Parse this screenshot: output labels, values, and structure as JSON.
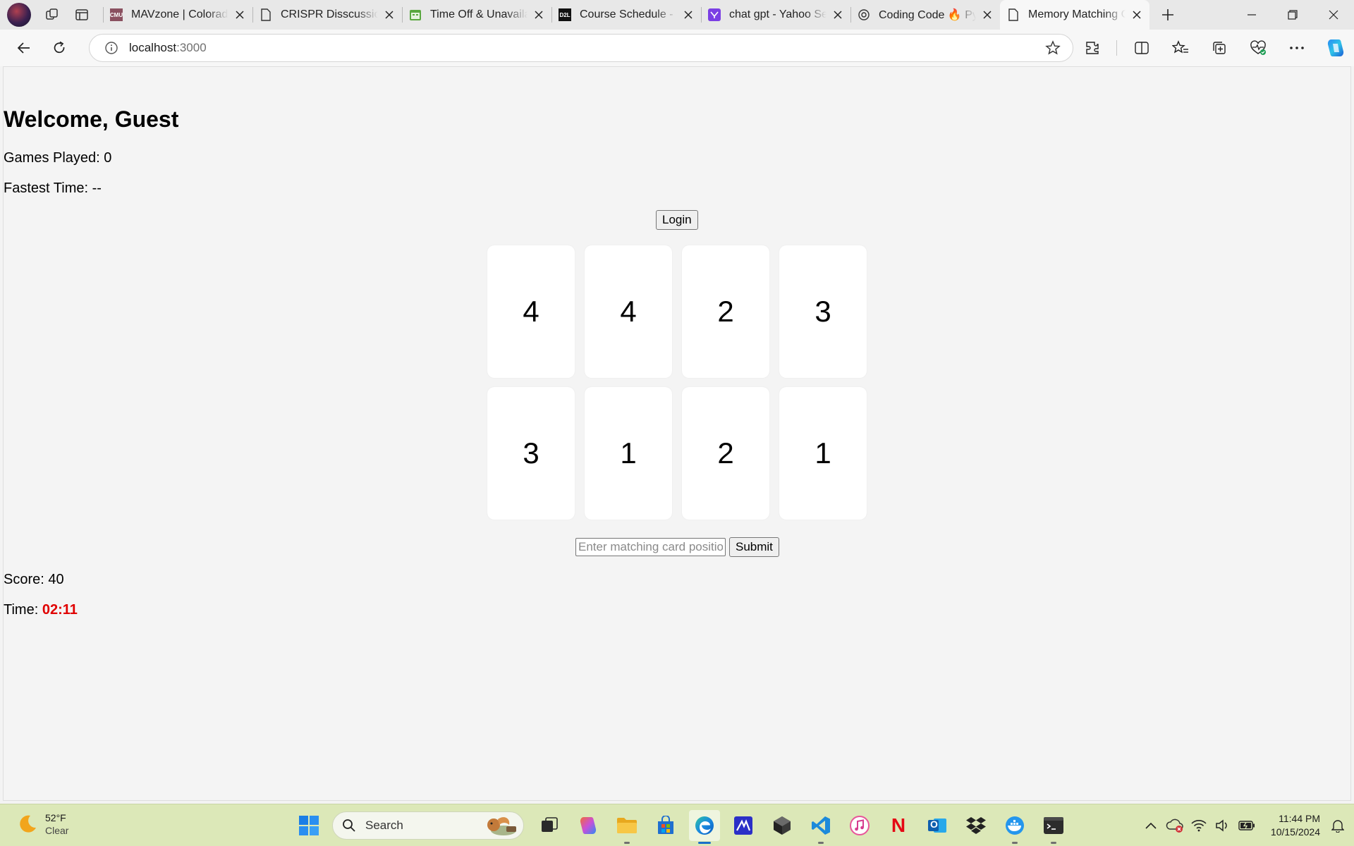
{
  "browser": {
    "tabs": [
      {
        "title": "MAVzone | Colorado",
        "favicon": "mavzone-icon"
      },
      {
        "title": "CRISPR Disscussion",
        "favicon": "document-icon"
      },
      {
        "title": "Time Off & Unavailab",
        "favicon": "calendar-icon"
      },
      {
        "title": "Course Schedule - C",
        "favicon": "d2l-icon"
      },
      {
        "title": "chat gpt - Yahoo Sea",
        "favicon": "yahoo-icon"
      },
      {
        "title": "Coding Code 🔥 Pyt",
        "favicon": "openai-icon"
      },
      {
        "title": "Memory Matching G",
        "favicon": "document-icon",
        "active": true
      }
    ],
    "address": {
      "host": "localhost",
      "port": ":3000"
    },
    "favicon_labels": {
      "mavzone": "CMU",
      "d2l": "D2L"
    }
  },
  "page": {
    "welcome": "Welcome, Guest",
    "games_played": "Games Played: 0",
    "fastest_time": "Fastest Time: --",
    "login_label": "Login",
    "cards": [
      "4",
      "4",
      "2",
      "3",
      "3",
      "1",
      "2",
      "1"
    ],
    "input_placeholder": "Enter matching card positions",
    "submit_label": "Submit",
    "score": "Score: 40",
    "time_label": "Time: ",
    "time_value": "02:11",
    "timer_color": "#e00000"
  },
  "taskbar": {
    "weather_temp": "52°F",
    "weather_cond": "Clear",
    "search_label": "Search",
    "apps": [
      "task-view-icon",
      "copilot-icon",
      "file-explorer-icon",
      "microsoft-store-icon",
      "edge-icon",
      "app-icon",
      "unity-icon",
      "vscode-icon",
      "itunes-icon",
      "netflix-icon",
      "outlook-icon",
      "dropbox-icon",
      "docker-icon",
      "terminal-icon"
    ],
    "netflix_letter": "N",
    "outlook_letter": "O",
    "clock_time": "11:44 PM",
    "clock_date": "10/15/2024"
  }
}
